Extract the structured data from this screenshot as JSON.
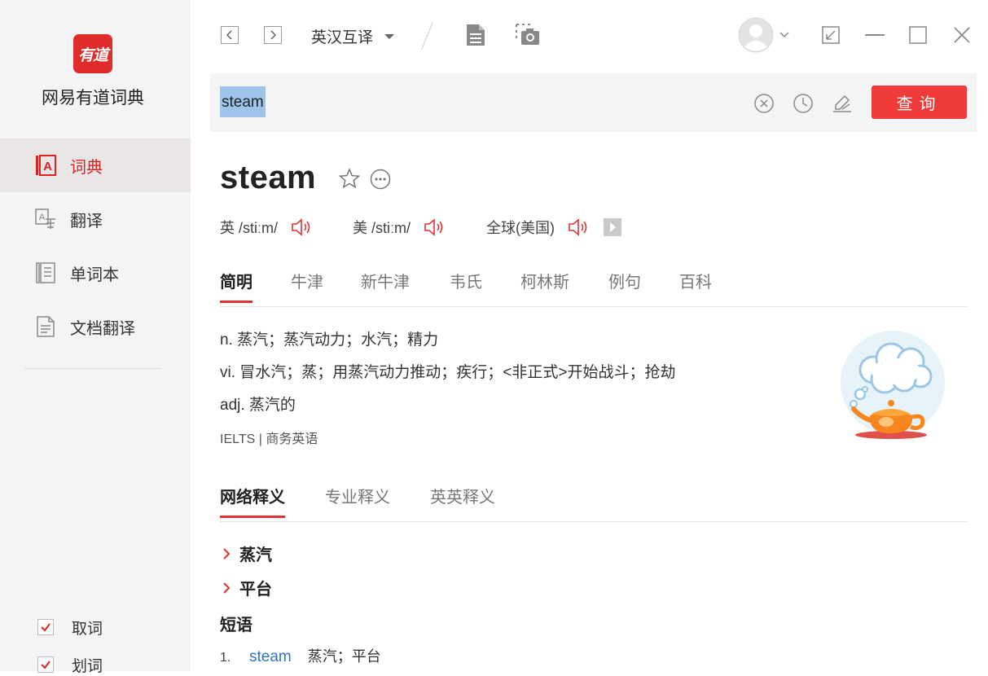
{
  "app": {
    "logo_text": "有道",
    "name": "网易有道词典"
  },
  "sidebar": {
    "items": [
      {
        "label": "词典",
        "icon": "dictionary-icon",
        "active": true
      },
      {
        "label": "翻译",
        "icon": "translate-icon",
        "active": false
      },
      {
        "label": "单词本",
        "icon": "wordbook-icon",
        "active": false
      },
      {
        "label": "文档翻译",
        "icon": "document-translate-icon",
        "active": false
      }
    ],
    "options": [
      {
        "label": "取词",
        "checked": true
      },
      {
        "label": "划词",
        "checked": true
      }
    ]
  },
  "toolbar": {
    "mode": "英汉互译"
  },
  "search": {
    "value": "steam",
    "query_label": "查询"
  },
  "word": {
    "headword": "steam",
    "pron_uk_label": "英 /stiːm/",
    "pron_us_label": "美 /stiːm/",
    "pron_global_label": "全球(美国)"
  },
  "tabs": [
    "简明",
    "牛津",
    "新牛津",
    "韦氏",
    "柯林斯",
    "例句",
    "百科"
  ],
  "definitions": [
    "n. 蒸汽；蒸汽动力；水汽；精力",
    "vi. 冒水汽；蒸；用蒸汽动力推动；疾行；<非正式>开始战斗；抢劫",
    "adj. 蒸汽的"
  ],
  "exam_tags": "IELTS | 商务英语",
  "web_tabs": [
    "网络释义",
    "专业释义",
    "英英释义"
  ],
  "web_defs": [
    "蒸汽",
    "平台"
  ],
  "phrases": {
    "title": "短语",
    "items": [
      {
        "num": "1.",
        "en": "steam",
        "zh": "蒸汽；平台"
      }
    ]
  },
  "colors": {
    "accent": "#e02b2b",
    "link": "#2c74c9",
    "highlight": "#9ec4ec"
  }
}
